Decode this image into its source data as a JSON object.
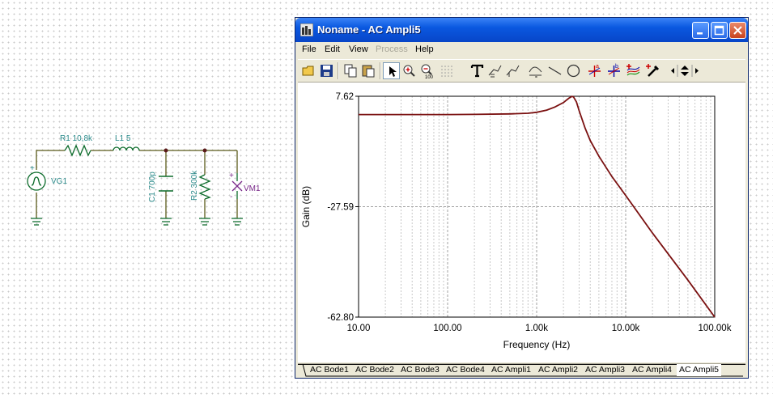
{
  "schematic": {
    "r1_label": "R1 10,8k",
    "l1_label": "L1 5",
    "c1_label": "C1 700p",
    "r2_label": "R2 300k",
    "vg_label": "VG1",
    "vm_label": "VM1",
    "plus": "+",
    "minus": "-"
  },
  "window": {
    "title": "Noname - AC Ampli5",
    "menu": [
      {
        "label": "File",
        "enabled": true
      },
      {
        "label": "Edit",
        "enabled": true
      },
      {
        "label": "View",
        "enabled": true
      },
      {
        "label": "Process",
        "enabled": false
      },
      {
        "label": "Help",
        "enabled": true
      }
    ],
    "toolbar": [
      "open-icon",
      "save-icon",
      "copy-icon",
      "paste-icon",
      "pointer-icon",
      "zoom-in-icon",
      "zoom-out-icon",
      "grid-icon",
      "text-icon",
      "axis-annotation-icon",
      "curve-annotation-icon",
      "slope-annotation-icon",
      "line-icon",
      "circle-icon",
      "cursor-a-icon",
      "cursor-b-icon",
      "add-curve-icon",
      "pick-color-icon",
      "move-arrows-icon"
    ],
    "tabs": [
      "AC Bode1",
      "AC Bode2",
      "AC Bode3",
      "AC Bode4",
      "AC Ampli1",
      "AC Ampli2",
      "AC Ampli3",
      "AC Ampli4",
      "AC Ampli5"
    ],
    "active_tab": "AC Ampli5",
    "curve_color": "#7a1010",
    "accent_color": "#0a58e0"
  },
  "chart_data": {
    "type": "line",
    "title": "",
    "xlabel": "Frequency (Hz)",
    "ylabel": "Gain (dB)",
    "x_scale": "log",
    "xlim": [
      10,
      100000
    ],
    "ylim": [
      -62.8,
      7.62
    ],
    "x_ticks": [
      "10.00",
      "100.00",
      "1.00k",
      "10.00k",
      "100.00k"
    ],
    "y_ticks": [
      "7.62",
      "-27.59",
      "-62.80"
    ],
    "grid": true,
    "legend": "none",
    "series": [
      {
        "x": [
          10,
          20,
          50,
          100,
          200,
          500,
          800,
          1000,
          1300,
          1600,
          2000,
          2300,
          2500,
          2600,
          2800,
          3000,
          3500,
          4000,
          5000,
          7000,
          10000,
          20000,
          50000,
          100000
        ],
        "values": [
          1.8,
          1.8,
          1.8,
          1.8,
          1.85,
          2.0,
          2.2,
          2.5,
          3.2,
          4.2,
          5.6,
          7.0,
          7.6,
          7.4,
          5.8,
          3.0,
          -2.5,
          -6.5,
          -11.5,
          -18.0,
          -24.0,
          -36.0,
          -51.0,
          -62.8
        ]
      }
    ]
  }
}
